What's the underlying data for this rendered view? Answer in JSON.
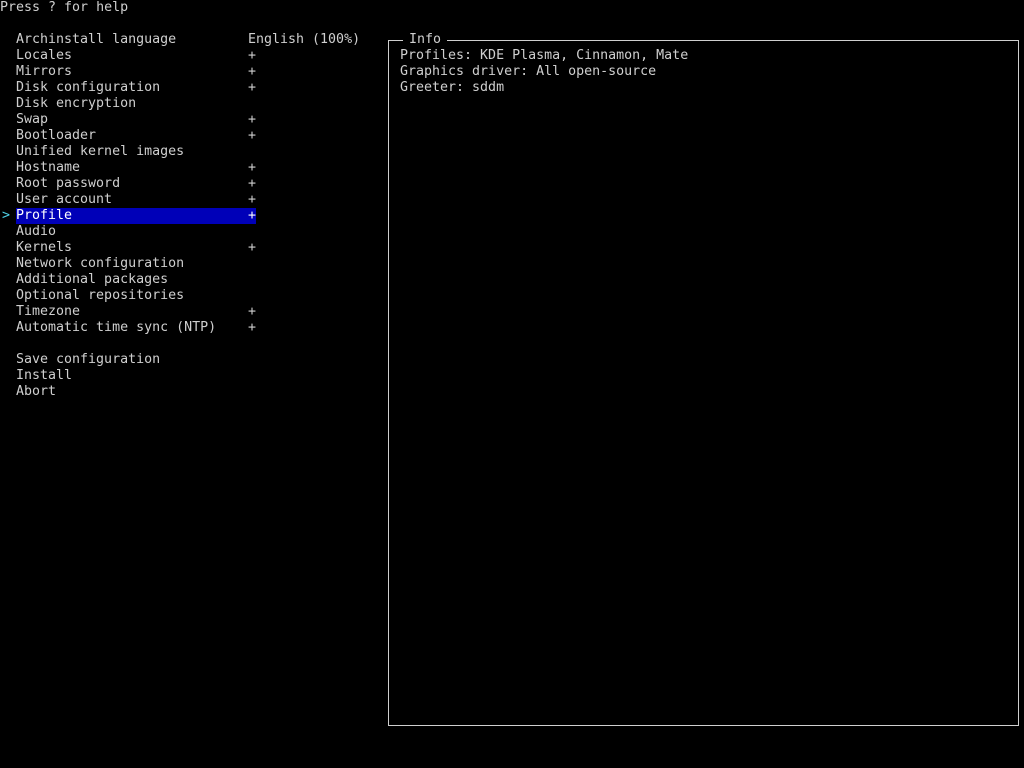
{
  "help_text": "Press ? for help",
  "cursor_glyph": ">",
  "menu": {
    "items": [
      {
        "label": "Archinstall language",
        "value": "English (100%)"
      },
      {
        "label": "Locales",
        "value": "+"
      },
      {
        "label": "Mirrors",
        "value": "+"
      },
      {
        "label": "Disk configuration",
        "value": "+"
      },
      {
        "label": "Disk encryption",
        "value": ""
      },
      {
        "label": "Swap",
        "value": "+"
      },
      {
        "label": "Bootloader",
        "value": "+"
      },
      {
        "label": "Unified kernel images",
        "value": ""
      },
      {
        "label": "Hostname",
        "value": "+"
      },
      {
        "label": "Root password",
        "value": "+"
      },
      {
        "label": "User account",
        "value": "+"
      },
      {
        "label": "Profile",
        "value": "+"
      },
      {
        "label": "Audio",
        "value": ""
      },
      {
        "label": "Kernels",
        "value": "+"
      },
      {
        "label": "Network configuration",
        "value": ""
      },
      {
        "label": "Additional packages",
        "value": ""
      },
      {
        "label": "Optional repositories",
        "value": ""
      },
      {
        "label": "Timezone",
        "value": "+"
      },
      {
        "label": "Automatic time sync (NTP)",
        "value": "+"
      }
    ],
    "actions": [
      {
        "label": "Save configuration"
      },
      {
        "label": "Install"
      },
      {
        "label": "Abort"
      }
    ]
  },
  "info": {
    "title": "Info",
    "lines": [
      "Profiles: KDE Plasma, Cinnamon, Mate",
      "Graphics driver: All open-source",
      "Greeter: sddm"
    ]
  },
  "colors": {
    "background": "#000000",
    "text": "#cfcfcf",
    "selection_background": "#0000b8",
    "cursor": "#4fd1e6"
  }
}
